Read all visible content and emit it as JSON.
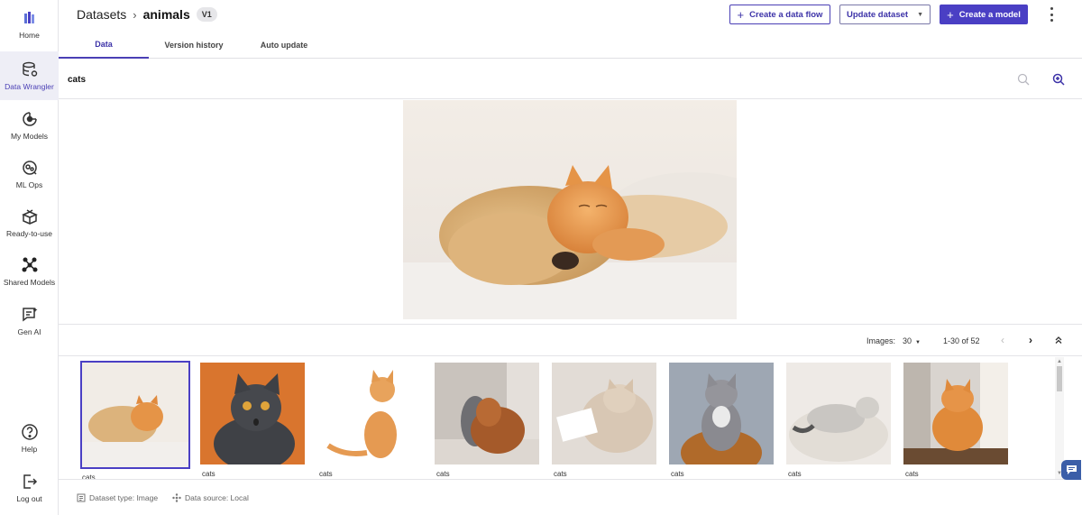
{
  "sidebar": {
    "items": [
      {
        "label": "Home",
        "icon": "logo-icon"
      },
      {
        "label": "Data Wrangler",
        "icon": "database-gear-icon"
      },
      {
        "label": "My Models",
        "icon": "model-icon"
      },
      {
        "label": "ML Ops",
        "icon": "ml-ops-icon"
      },
      {
        "label": "Ready-to-use",
        "icon": "box-icon"
      },
      {
        "label": "Shared Models",
        "icon": "share-nodes-icon"
      },
      {
        "label": "Gen AI",
        "icon": "gen-ai-icon"
      },
      {
        "label": "Help",
        "icon": "help-icon"
      },
      {
        "label": "Log out",
        "icon": "logout-icon"
      }
    ]
  },
  "header": {
    "breadcrumb_root": "Datasets",
    "breadcrumb_current": "animals",
    "version": "V1",
    "create_flow_label": "Create a data flow",
    "update_dataset_label": "Update dataset",
    "create_model_label": "Create a model"
  },
  "tabs": [
    {
      "label": "Data"
    },
    {
      "label": "Version history"
    },
    {
      "label": "Auto update"
    }
  ],
  "label_filter": "cats",
  "pager": {
    "images_label": "Images:",
    "page_size": "30",
    "range": "1-30 of 52"
  },
  "thumbnails": [
    {
      "caption": "cats"
    },
    {
      "caption": "cats"
    },
    {
      "caption": "cats"
    },
    {
      "caption": "cats"
    },
    {
      "caption": "cats"
    },
    {
      "caption": "cats"
    },
    {
      "caption": "cats"
    },
    {
      "caption": "cats"
    }
  ],
  "footer": {
    "dataset_type": "Dataset type: Image",
    "data_source": "Data source: Local"
  },
  "colors": {
    "accent": "#4a3fc4",
    "accent_text": "#3d33a8",
    "chat_fab": "#3b5ea8"
  }
}
